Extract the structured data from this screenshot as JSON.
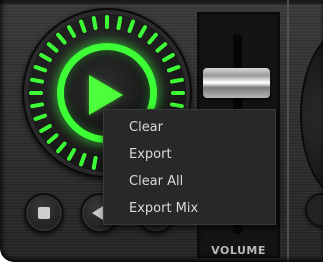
{
  "theme": {
    "accent": "#3dff35",
    "background": "#2f2f2f",
    "menu_background": "#282828",
    "menu_text": "#dadada"
  },
  "deck": {
    "play_icon": "play-icon",
    "transport_icons": [
      "stop-icon",
      "previous-icon"
    ]
  },
  "mixer": {
    "volume_label": "VOLUME"
  },
  "context_menu": {
    "items": [
      "Clear",
      "Export",
      "Clear All",
      "Export Mix"
    ]
  }
}
